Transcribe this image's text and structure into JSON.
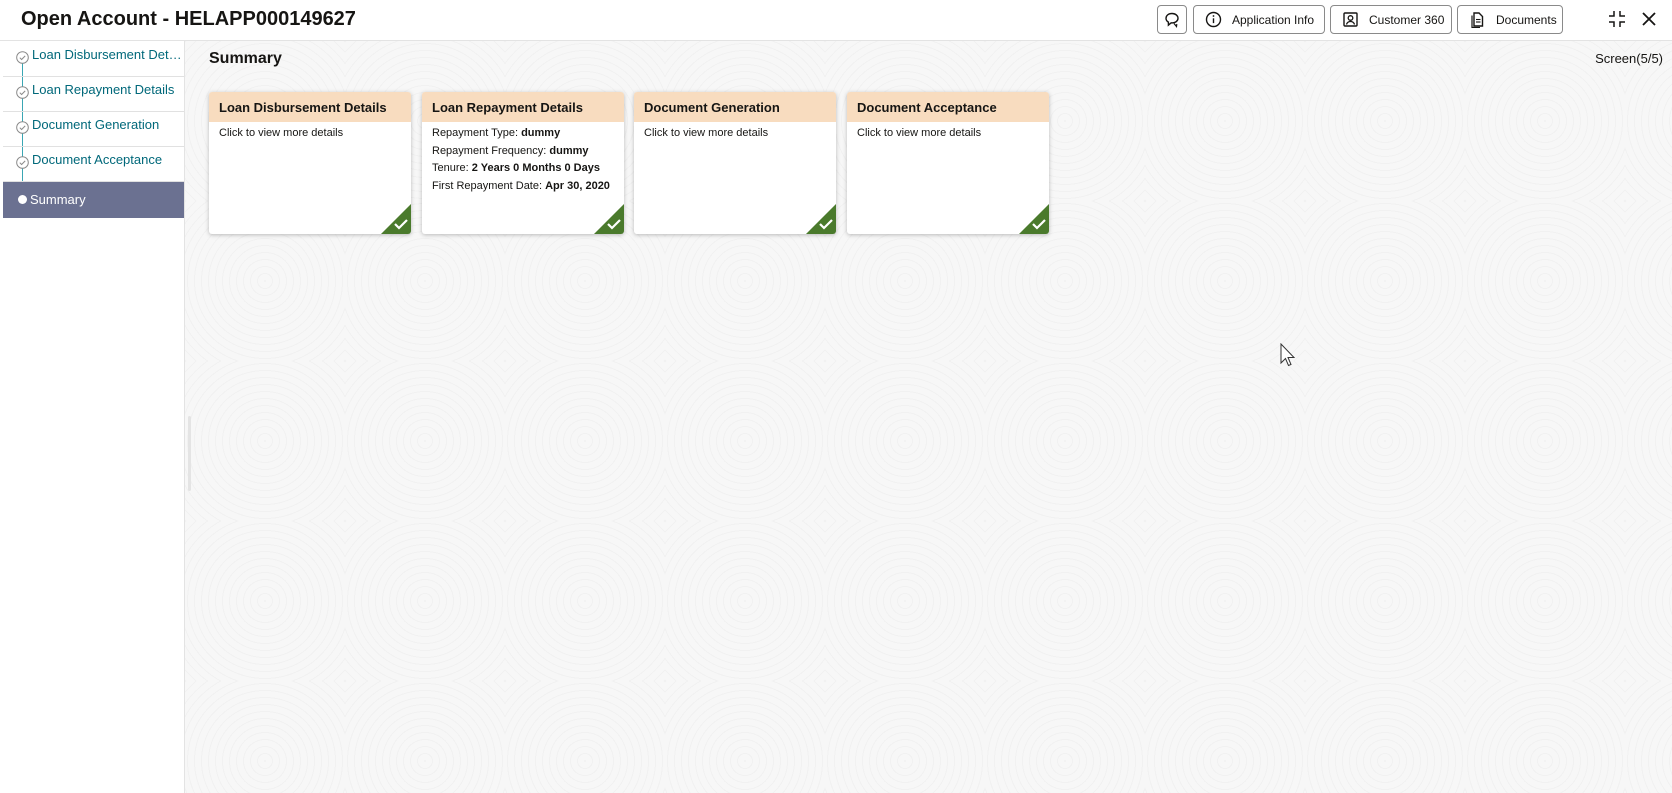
{
  "header": {
    "title": "Open Account - HELAPP000149627",
    "buttons": {
      "application_info": "Application Info",
      "customer_360": "Customer 360",
      "documents": "Documents"
    },
    "icons": [
      "chat-bubble-icon",
      "info-icon",
      "contact-card-icon",
      "document-icon",
      "minimize-icon",
      "close-icon"
    ]
  },
  "sidebar": {
    "items": [
      {
        "label": "Loan Disbursement Details",
        "status": "completed"
      },
      {
        "label": "Loan Repayment Details",
        "status": "completed"
      },
      {
        "label": "Document Generation",
        "status": "completed"
      },
      {
        "label": "Document Acceptance",
        "status": "completed"
      },
      {
        "label": "Summary",
        "status": "active"
      }
    ]
  },
  "main": {
    "title": "Summary",
    "screen_count": "Screen(5/5)",
    "cards": [
      {
        "title": "Loan Disbursement Details",
        "body": "Click to view more details",
        "status": "completed"
      },
      {
        "title": "Loan Repayment Details",
        "fields": [
          {
            "label": "Repayment Type:",
            "value": "dummy"
          },
          {
            "label": "Repayment Frequency:",
            "value": "dummy"
          },
          {
            "label": "Tenure:",
            "value": "2 Years 0 Months 0 Days"
          },
          {
            "label": "First Repayment Date:",
            "value": "Apr 30, 2020"
          }
        ],
        "status": "completed"
      },
      {
        "title": "Document Generation",
        "body": "Click to view more details",
        "status": "completed"
      },
      {
        "title": "Document Acceptance",
        "body": "Click to view more details",
        "status": "completed"
      }
    ]
  },
  "colors": {
    "card_header": "#f8dcbf",
    "active_nav": "#6b7191",
    "nav_text": "#00687a",
    "completed_badge": "#4a7a2c"
  }
}
